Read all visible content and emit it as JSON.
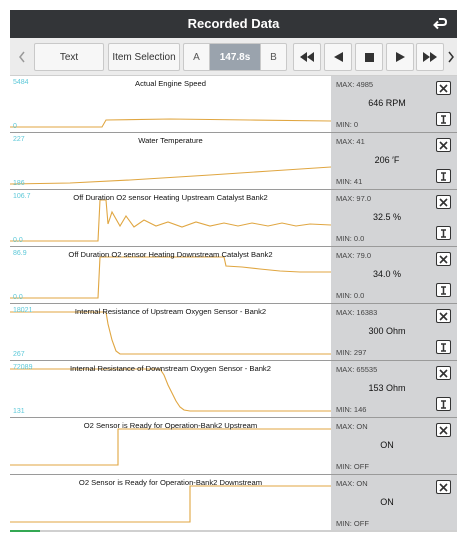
{
  "header": {
    "title": "Recorded Data"
  },
  "toolbar": {
    "text_label": "Text",
    "item_selection_label": "Item Selection",
    "a_label": "A",
    "time_label": "147.8s",
    "b_label": "B"
  },
  "channels": [
    {
      "title": "Actual Engine Speed",
      "axis_max": "5484",
      "axis_min": "0",
      "max": "MAX: 4985",
      "value": "646 RPM",
      "min": "MIN: 0",
      "has_info": true
    },
    {
      "title": "Water Temperature",
      "axis_max": "227",
      "axis_min": "186",
      "max": "MAX: 41",
      "value": "206 ′F",
      "min": "MIN: 41",
      "has_info": true
    },
    {
      "title": "Off Duration O2 sensor Heating Upstream Catalyst Bank2",
      "axis_max": "106.7",
      "axis_min": "0.0",
      "max": "MAX: 97.0",
      "value": "32.5 %",
      "min": "MIN: 0.0",
      "has_info": true
    },
    {
      "title": "Off Duration O2 sensor Heating Downstream Catalyst Bank2",
      "axis_max": "86.9",
      "axis_min": "0.0",
      "max": "MAX: 79.0",
      "value": "34.0 %",
      "min": "MIN: 0.0",
      "has_info": true
    },
    {
      "title": "Internal Resistance of Upstream Oxygen Sensor - Bank2",
      "axis_max": "18021",
      "axis_min": "267",
      "max": "MAX: 16383",
      "value": "300 Ohm",
      "min": "MIN: 297",
      "has_info": true
    },
    {
      "title": "Internal Resistance of Downstream Oxygen Sensor - Bank2",
      "axis_max": "72089",
      "axis_min": "131",
      "max": "MAX: 65535",
      "value": "153 Ohm",
      "min": "MIN: 146",
      "has_info": true
    },
    {
      "title": "O2 Sensor is Ready for Operation-Bank2 Upstream",
      "axis_max": "",
      "axis_min": "",
      "max": "MAX: ON",
      "value": "ON",
      "min": "MIN: OFF",
      "has_info": false
    },
    {
      "title": "O2 Sensor is Ready for Operation-Bank2 Downstream",
      "axis_max": "",
      "axis_min": "",
      "max": "MAX: ON",
      "value": "ON",
      "min": "MIN: OFF",
      "has_info": false
    }
  ],
  "colors": {
    "trace": "#e0a641",
    "axis_text": "#5cc8d8",
    "header_bg": "#333538",
    "panel_bg": "#d3d4d6"
  },
  "icons": {
    "back": "return-arrow-icon",
    "prev": "chevron-left-icon",
    "next": "chevron-right-icon",
    "rewind": "rewind-icon",
    "step_back": "step-back-icon",
    "stop": "stop-icon",
    "play": "play-icon",
    "fast_forward": "fast-forward-icon",
    "close": "close-icon",
    "info": "info-icon"
  }
}
